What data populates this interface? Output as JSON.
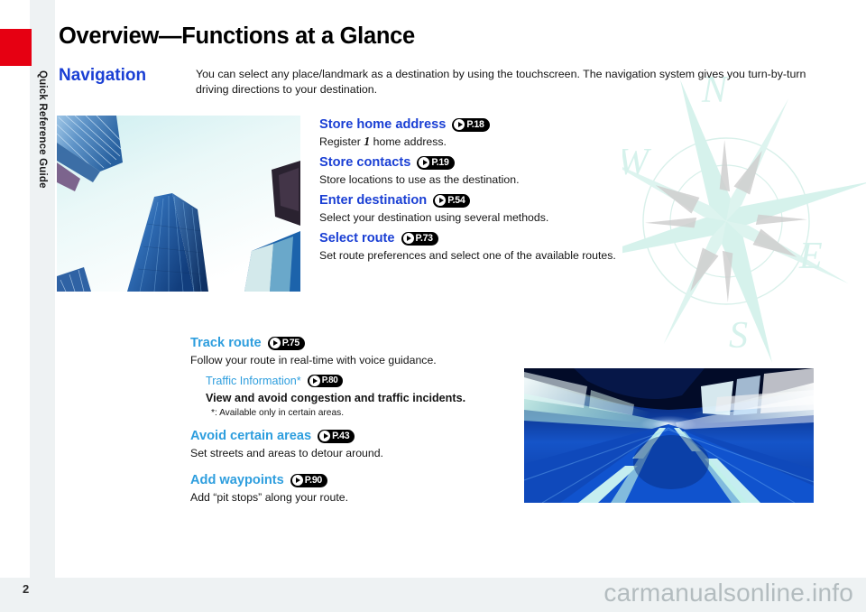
{
  "document": {
    "page_title": "Overview—Functions at a Glance",
    "page_number": "2",
    "tab_label": "Quick Reference Guide",
    "watermark": "carmanualsonline.info",
    "tab_color": "#e60012",
    "heading_color": "#1a3fd4",
    "heading_color_light": "#2e9ede"
  },
  "section": {
    "title": "Navigation",
    "intro": "You can select any place/landmark as a destination by using the touchscreen. The navigation system gives you turn-by-turn driving directions to your destination."
  },
  "features_top": [
    {
      "title": "Store home address",
      "ref": "P.18",
      "desc_before": "Register ",
      "desc_numeral": "1",
      "desc_after": " home address."
    },
    {
      "title": "Store contacts",
      "ref": "P.19",
      "desc": "Store locations to use as the destination."
    },
    {
      "title": "Enter destination",
      "ref": "P.54",
      "desc": "Select your destination using several methods."
    },
    {
      "title": "Select route",
      "ref": "P.73",
      "desc": "Set route preferences and select one of the available routes."
    }
  ],
  "features_bottom": [
    {
      "title": "Track route",
      "ref": "P.75",
      "desc": "Follow your route in real-time with voice guidance."
    },
    {
      "title": "Traffic Information*",
      "ref": "P.80",
      "desc": "View and avoid congestion and traffic incidents.",
      "note": "*: Available only in certain areas."
    },
    {
      "title": "Avoid certain areas",
      "ref": "P.43",
      "desc": "Set streets and areas to detour around."
    },
    {
      "title": "Add waypoints",
      "ref": "P.90",
      "desc": "Add “pit stops” along your route."
    }
  ],
  "compass": {
    "north": "N",
    "west": "W",
    "east": "E",
    "south": "S"
  },
  "images": {
    "buildings_alt": "skyscrapers-looking-up-photo",
    "tunnel_alt": "motion-blur-tunnel-road-photo"
  }
}
